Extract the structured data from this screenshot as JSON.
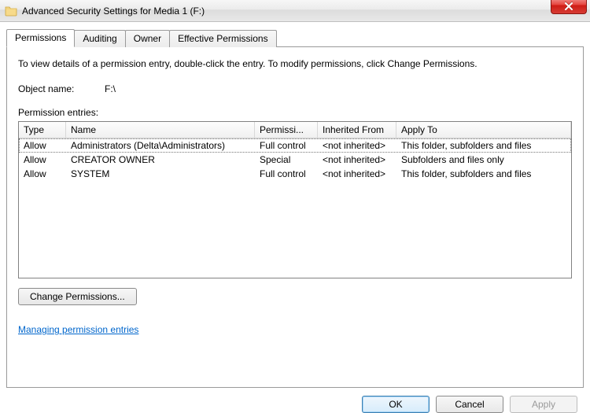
{
  "window": {
    "title": "Advanced Security Settings for Media 1 (F:)"
  },
  "tabs": [
    {
      "label": "Permissions"
    },
    {
      "label": "Auditing"
    },
    {
      "label": "Owner"
    },
    {
      "label": "Effective Permissions"
    }
  ],
  "info_text": "To view details of a permission entry, double-click the entry. To modify permissions, click Change Permissions.",
  "object_name_label": "Object name:",
  "object_name_value": "F:\\",
  "permission_entries_label": "Permission entries:",
  "columns": {
    "type": "Type",
    "name": "Name",
    "permission": "Permissi...",
    "inherited": "Inherited From",
    "apply": "Apply To"
  },
  "entries": [
    {
      "type": "Allow",
      "name": "Administrators (Delta\\Administrators)",
      "permission": "Full control",
      "inherited": "<not inherited>",
      "apply": "This folder, subfolders and files"
    },
    {
      "type": "Allow",
      "name": "CREATOR OWNER",
      "permission": "Special",
      "inherited": "<not inherited>",
      "apply": "Subfolders and files only"
    },
    {
      "type": "Allow",
      "name": "SYSTEM",
      "permission": "Full control",
      "inherited": "<not inherited>",
      "apply": "This folder, subfolders and files"
    }
  ],
  "buttons": {
    "change_permissions": "Change Permissions...",
    "ok": "OK",
    "cancel": "Cancel",
    "apply": "Apply"
  },
  "link_text": "Managing permission entries"
}
